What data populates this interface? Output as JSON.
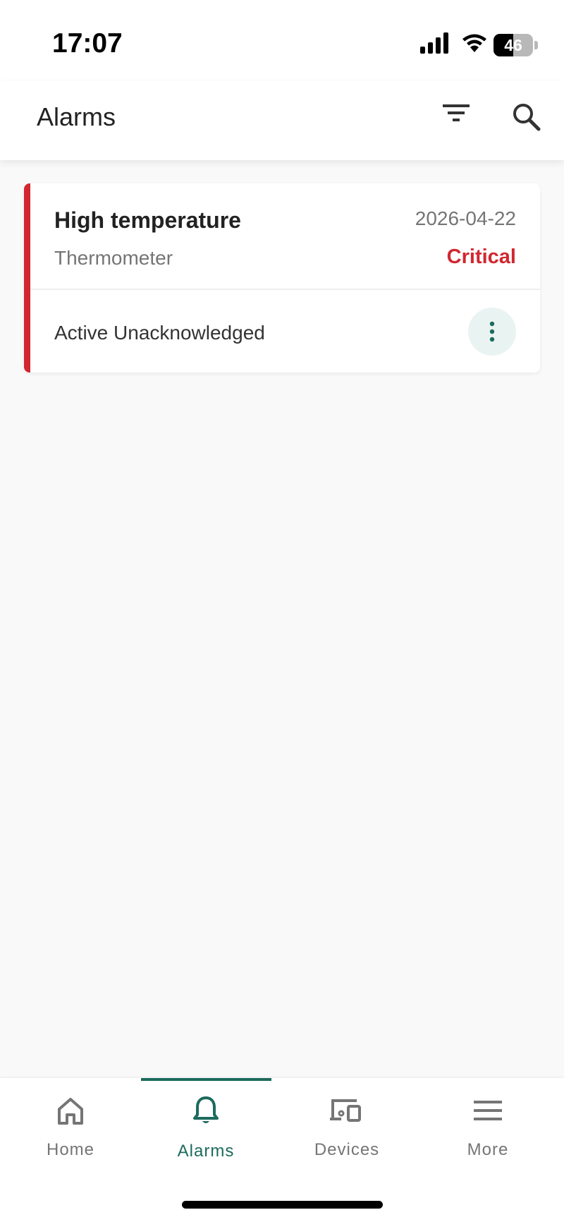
{
  "status_bar": {
    "time": "17:07",
    "battery": "46"
  },
  "app_bar": {
    "title": "Alarms",
    "filter_icon": "filter-list-icon",
    "search_icon": "search-icon"
  },
  "alarms": [
    {
      "title": "High temperature",
      "date": "2026-04-22",
      "originator": "Thermometer",
      "severity": "Critical",
      "status": "Active Unacknowledged",
      "severity_color": "#d12730"
    }
  ],
  "bottom_nav": {
    "items": [
      {
        "label": "Home",
        "icon": "home-icon",
        "active": false
      },
      {
        "label": "Alarms",
        "icon": "bell-icon",
        "active": true
      },
      {
        "label": "Devices",
        "icon": "devices-icon",
        "active": false
      },
      {
        "label": "More",
        "icon": "menu-icon",
        "active": false
      }
    ]
  },
  "colors": {
    "accent": "#1d6b5d",
    "critical": "#d12730",
    "background": "#f9f9f9"
  }
}
